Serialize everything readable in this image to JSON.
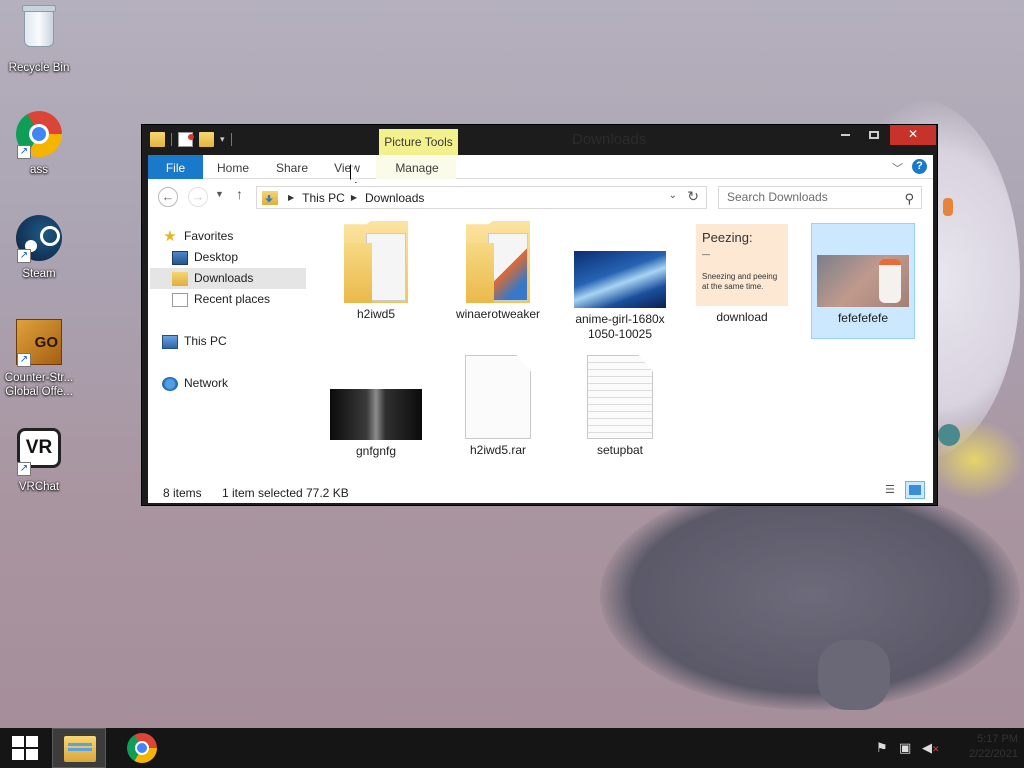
{
  "desktop": {
    "icons": [
      {
        "label": "Recycle Bin",
        "icon": "recycle-bin-icon"
      },
      {
        "label": "ass",
        "icon": "chrome-icon"
      },
      {
        "label": "Steam",
        "icon": "steam-icon"
      },
      {
        "label": "Counter-Str...\nGlobal Offe...",
        "line1": "Counter-Str...",
        "line2": "Global Offe...",
        "icon": "csgo-icon",
        "icon_text": "GO"
      },
      {
        "label": "VRChat",
        "icon": "vrchat-icon",
        "icon_text": "VR"
      }
    ]
  },
  "window": {
    "title": "Downloads",
    "contextual_tab": "Picture Tools",
    "ribbon_tabs": {
      "file": "File",
      "home": "Home",
      "share": "Share",
      "view": "View",
      "manage": "Manage"
    },
    "address": {
      "crumbs": [
        "This PC",
        "Downloads"
      ]
    },
    "search": {
      "placeholder": "Search Downloads"
    },
    "nav_pane": {
      "favorites": "Favorites",
      "desktop": "Desktop",
      "downloads": "Downloads",
      "recent": "Recent places",
      "this_pc": "This PC",
      "network": "Network"
    },
    "files": [
      {
        "name": "h2iwd5",
        "type": "folder"
      },
      {
        "name": "winaerotweaker",
        "type": "folder"
      },
      {
        "name": "anime-girl-1680x1050-10025",
        "line1": "anime-girl-1680x",
        "line2": "1050-10025",
        "type": "image"
      },
      {
        "name": "download",
        "type": "image",
        "preview_title": "Peezing:",
        "preview_dash": "—",
        "preview_text": "Sneezing and peeing at the same time."
      },
      {
        "name": "fefefefefe",
        "type": "image",
        "selected": true
      },
      {
        "name": "gnfgnfg",
        "type": "image"
      },
      {
        "name": "h2iwd5.rar",
        "type": "archive"
      },
      {
        "name": "setupbat",
        "type": "text"
      }
    ],
    "status": {
      "count": "8 items",
      "selected": "1 item selected",
      "size": "77.2 KB"
    }
  },
  "taskbar": {
    "clock_time": "5:17 PM",
    "clock_date": "2/22/2021"
  }
}
